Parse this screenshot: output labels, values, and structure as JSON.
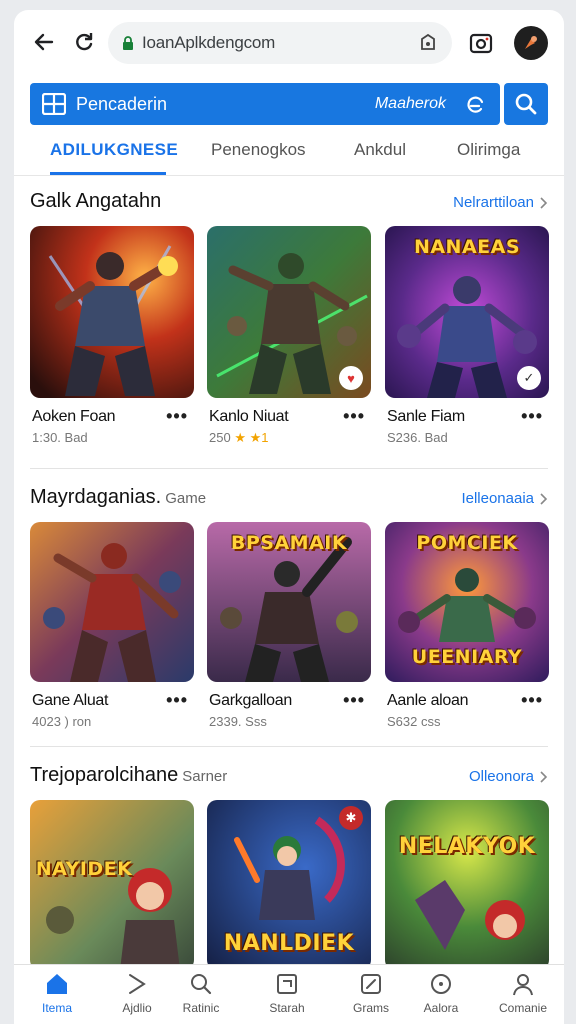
{
  "browser": {
    "url": "IoanAplkdengcom"
  },
  "search": {
    "placeholder": "Pencaderin",
    "right_text": "Maaherok"
  },
  "tabs": [
    {
      "label": "ADILUKGNESE",
      "active": true
    },
    {
      "label": "Penenogkos",
      "active": false
    },
    {
      "label": "Ankdul",
      "active": false
    },
    {
      "label": "Olirimga",
      "active": false
    }
  ],
  "sections": [
    {
      "title": "Galk Angatahn",
      "subtitle": "",
      "link": "Nelrarttiloan",
      "cards": [
        {
          "name": "Aoken Foan",
          "meta": "1:30. Bad",
          "stars": "",
          "banner": ""
        },
        {
          "name": "Kanlo Niuat",
          "meta": "250",
          "stars": "★ ★1",
          "banner": ""
        },
        {
          "name": "Sanle Fiam",
          "meta": "S236. Bad",
          "stars": "",
          "banner": "NANAEAS"
        }
      ]
    },
    {
      "title": "Mayrdaganias.",
      "subtitle": "Game",
      "link": "Ielleonaaia",
      "cards": [
        {
          "name": "Gane Aluat",
          "meta": "4023 ) ron",
          "stars": "",
          "banner": ""
        },
        {
          "name": "Garkgalloan",
          "meta": "2339. Sss",
          "stars": "",
          "banner": "BPSAMAIK"
        },
        {
          "name": "Aanle aloan",
          "meta": "S632 css",
          "stars": "",
          "banner": "POMCIEK"
        }
      ]
    },
    {
      "title": "Trejoparolcihane",
      "subtitle": "Sarner",
      "link": "Olleonora",
      "cards": [
        {
          "name": "",
          "meta": "",
          "stars": "",
          "banner": "NAYIDEK"
        },
        {
          "name": "",
          "meta": "",
          "stars": "",
          "banner": "NANLDIEK"
        },
        {
          "name": "",
          "meta": "",
          "stars": "",
          "banner": "NELAKYOK"
        }
      ]
    }
  ],
  "extra_banners": {
    "card_2_3_bottom": "UEENIARY"
  },
  "bottom_nav": [
    {
      "label": "Itema",
      "icon": "home-icon",
      "active": true
    },
    {
      "label": "Ajdlio",
      "icon": "cursor-icon",
      "active": false
    },
    {
      "label": "Ratinic",
      "icon": "search-icon",
      "active": false
    },
    {
      "label": "Starah",
      "icon": "square-icon",
      "active": false
    },
    {
      "label": "Grams",
      "icon": "edit-icon",
      "active": false
    },
    {
      "label": "Aalora",
      "icon": "compass-icon",
      "active": false
    },
    {
      "label": "Comanie",
      "icon": "person-icon",
      "active": false
    }
  ],
  "colors": {
    "accent": "#1877e0",
    "link": "#1a73e8"
  }
}
